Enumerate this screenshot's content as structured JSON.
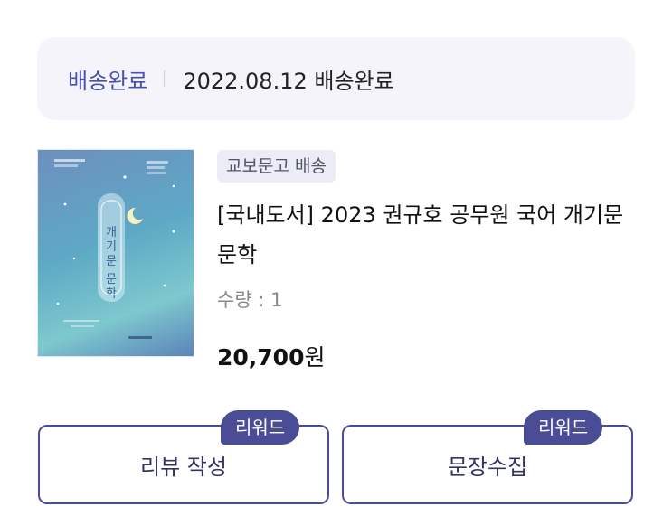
{
  "delivery": {
    "status_label": "배송완료",
    "status_detail": "2022.08.12 배송완료"
  },
  "product": {
    "badge": "교보문고 배송",
    "title": "[국내도서] 2023 권규호 공무원 국어 개기문 문학",
    "quantity": "수량 : 1",
    "price_value": "20,700",
    "price_unit": "원",
    "cover_title": "개기문 문학"
  },
  "actions": {
    "review_button": "리뷰 작성",
    "sentence_button": "문장수집",
    "reward_tag": "리워드"
  }
}
